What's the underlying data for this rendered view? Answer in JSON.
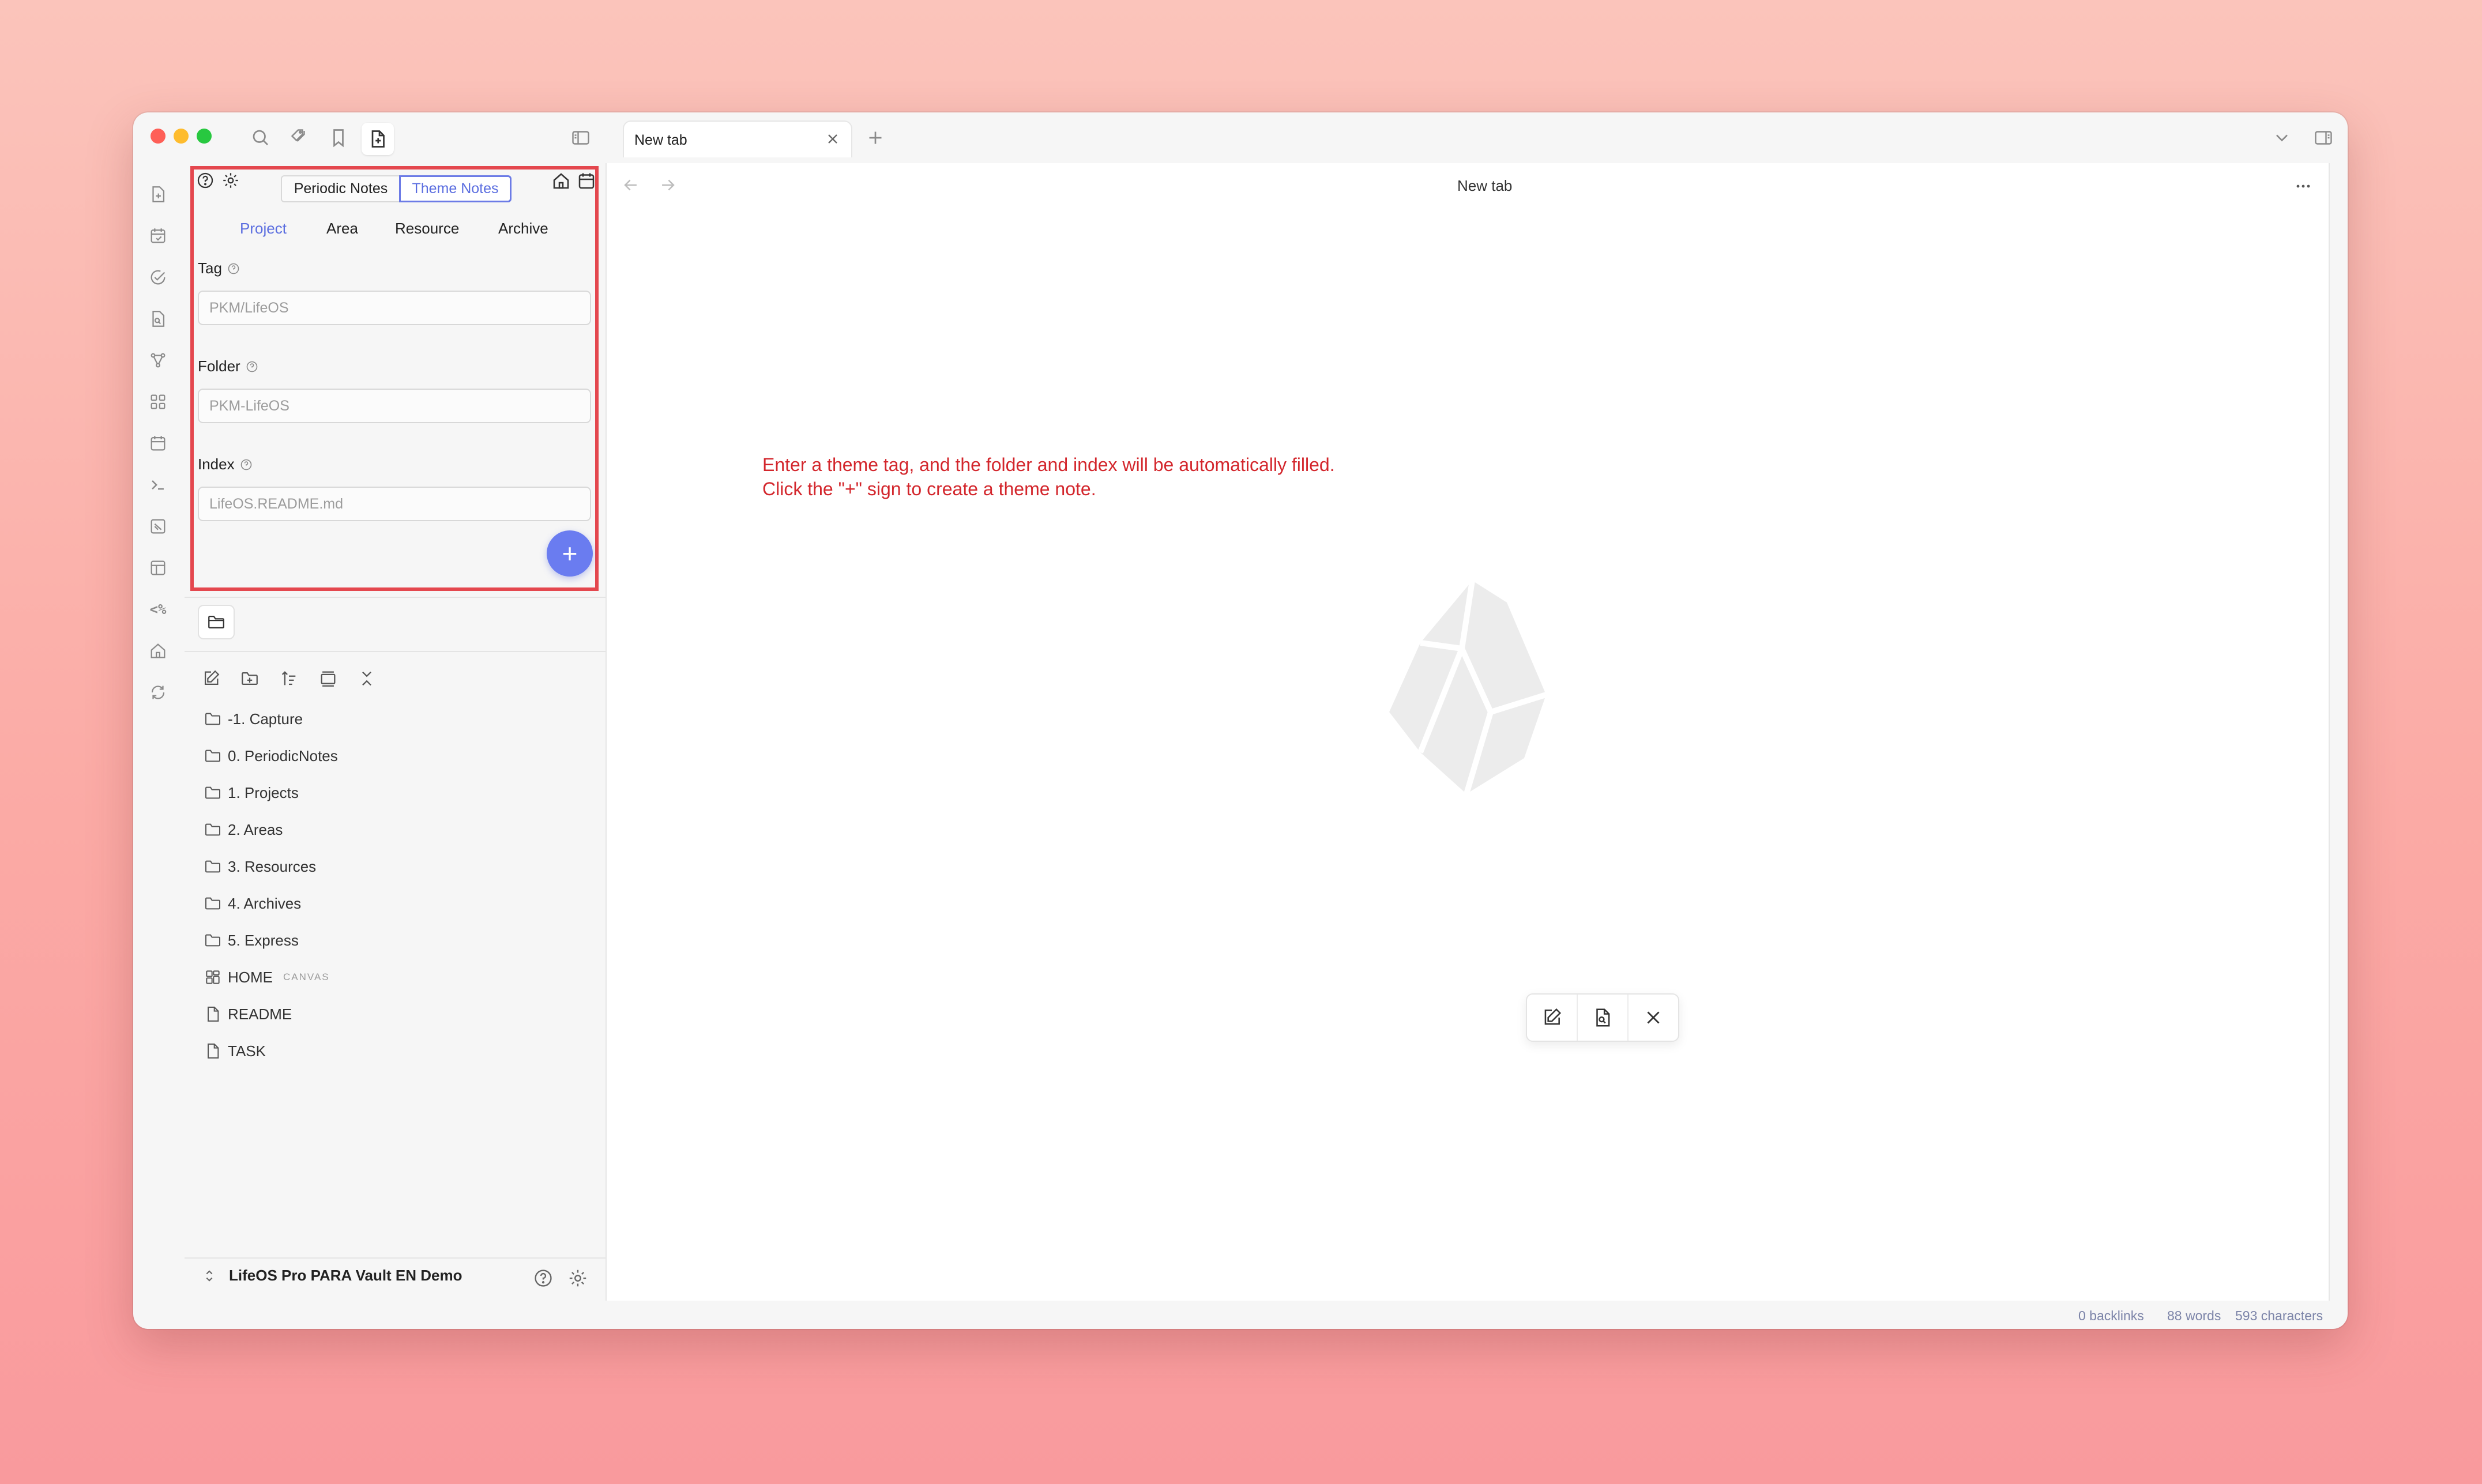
{
  "window": {
    "traffic_lights": {
      "close": "#fe5f57",
      "minimize": "#febc2e",
      "zoom": "#28c840"
    }
  },
  "titlebar": {
    "icons": [
      "search-icon",
      "tags-icon",
      "bookmark-icon",
      "new-note-icon",
      "sidebar-toggle-icon",
      "chevron-down-icon",
      "right-sidebar-icon"
    ]
  },
  "tabs": [
    {
      "label": "New tab"
    }
  ],
  "ribbon": {
    "icons": [
      "new-note-icon",
      "calendar-check-icon",
      "check-circle-icon",
      "file-search-icon",
      "graph-icon",
      "blocks-icon",
      "calendar-icon",
      "terminal-icon",
      "canvas-icon",
      "table-icon",
      "templater-icon",
      "home-icon",
      "sync-icon"
    ],
    "templater_text": "<%"
  },
  "plugin": {
    "segments": {
      "periodic": "Periodic Notes",
      "theme": "Theme Notes",
      "active": "Theme Notes"
    },
    "para_tabs": [
      "Project",
      "Area",
      "Resource",
      "Archive"
    ],
    "active_tab": "Project",
    "tag": {
      "label": "Tag",
      "placeholder": "PKM/LifeOS"
    },
    "folder": {
      "label": "Folder",
      "placeholder": "PKM-LifeOS"
    },
    "index": {
      "label": "Index",
      "placeholder": "LifeOS.README.md"
    },
    "add_symbol": "+",
    "highlight_color": "#e4474e",
    "accent_color": "#6a7cf0"
  },
  "file_tree": {
    "items": [
      {
        "name": "-1. Capture",
        "type": "folder"
      },
      {
        "name": "0. PeriodicNotes",
        "type": "folder"
      },
      {
        "name": "1. Projects",
        "type": "folder"
      },
      {
        "name": "2. Areas",
        "type": "folder"
      },
      {
        "name": "3. Resources",
        "type": "folder"
      },
      {
        "name": "4. Archives",
        "type": "folder"
      },
      {
        "name": "5. Express",
        "type": "folder"
      },
      {
        "name": "HOME",
        "type": "canvas",
        "badge": "CANVAS"
      },
      {
        "name": "README",
        "type": "file"
      },
      {
        "name": "TASK",
        "type": "file"
      }
    ]
  },
  "vault": {
    "name": "LifeOS Pro PARA Vault EN Demo"
  },
  "main": {
    "title": "New tab",
    "annotation": "Enter a theme tag, and the folder and index will be automatically filled. Click the \"+\" sign to create a theme note.",
    "annotation_color": "#d3262c"
  },
  "status_bar": {
    "backlinks": "0 backlinks",
    "words": "88 words",
    "characters": "593 characters"
  }
}
